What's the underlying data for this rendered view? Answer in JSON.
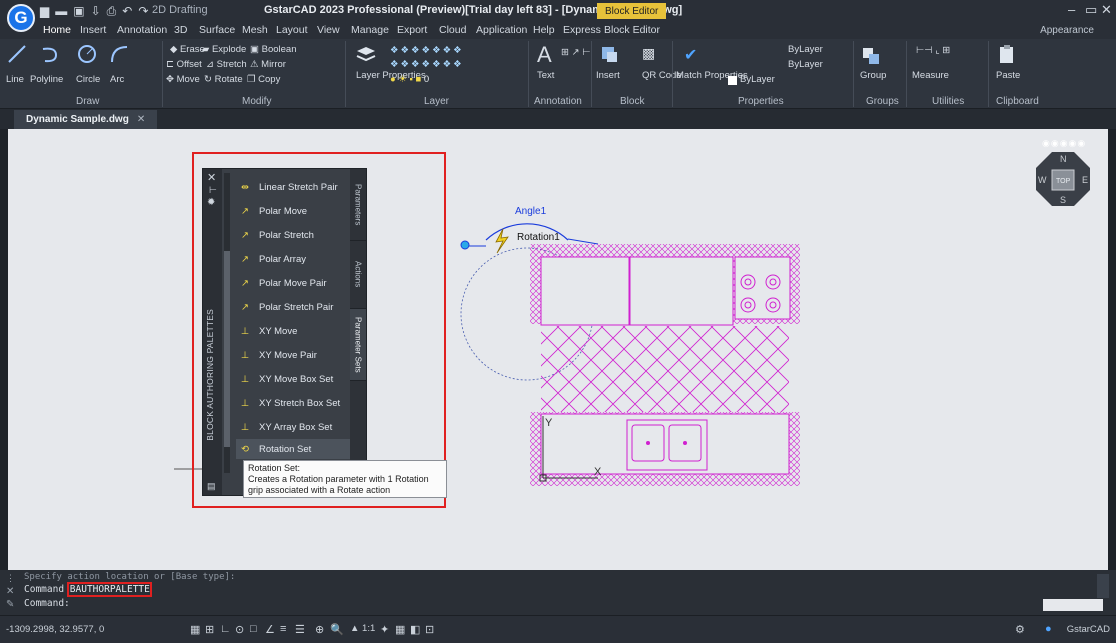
{
  "window": {
    "workspace": "2D Drafting",
    "title": "GstarCAD 2023 Professional (Preview)[Trial day left 83] - [Dynamic Sample.dwg]",
    "badge": "Block Editor",
    "logo": "G",
    "controls": [
      "–",
      "▭",
      "✕"
    ]
  },
  "menu": {
    "tabs": [
      "Home",
      "Insert",
      "Annotation",
      "3D",
      "Surface",
      "Mesh",
      "Layout",
      "View",
      "Manage",
      "Export",
      "Cloud",
      "Application",
      "Help",
      "Express",
      "Block Editor"
    ],
    "appearance": "Appearance"
  },
  "ribbon": {
    "draw": {
      "label": "Draw",
      "tools": [
        "Line",
        "Polyline",
        "Circle",
        "Arc"
      ]
    },
    "modify": {
      "label": "Modify",
      "tools": [
        "Erase",
        "Explode",
        "Boolean",
        "Offset",
        "Stretch",
        "Mirror",
        "Move",
        "Rotate",
        "Copy"
      ]
    },
    "layer": {
      "label": "Layer",
      "properties": "Layer Properties",
      "current": "0"
    },
    "annotation": {
      "label": "Annotation",
      "text": "Text"
    },
    "block": {
      "label": "Block",
      "insert": "Insert",
      "qr": "QR Code"
    },
    "properties": {
      "label": "Properties",
      "match": "Match Properties",
      "by1": "ByLayer",
      "by2": "ByLayer",
      "by3": "ByLayer"
    },
    "groups": {
      "label": "Groups",
      "group": "Group"
    },
    "utilities": {
      "label": "Utilities",
      "measure": "Measure"
    },
    "clipboard": {
      "label": "Clipboard",
      "paste": "Paste"
    }
  },
  "doc_tab": {
    "label": "Dynamic Sample.dwg",
    "close": "✕"
  },
  "canvas": {
    "viewcube": {
      "top": "TOP",
      "n": "N",
      "s": "S",
      "w": "W",
      "e": "E"
    },
    "angle_label": "Angle1",
    "rotation_label": "Rotation1",
    "axis_x": "X",
    "axis_y": "Y"
  },
  "palette": {
    "title": "BLOCK AUTHORING PALETTES",
    "items": [
      "Linear Stretch Pair",
      "Polar Move",
      "Polar Stretch",
      "Polar Array",
      "Polar Move Pair",
      "Polar Stretch Pair",
      "XY Move",
      "XY Move Pair",
      "XY Move Box Set",
      "XY Stretch Box Set",
      "XY Array Box Set",
      "Rotation Set"
    ],
    "tabs": [
      "Parameters",
      "Actions",
      "Parameter Sets"
    ]
  },
  "tooltip": {
    "title": "Rotation Set:",
    "body": "Creates a Rotation parameter with 1 Rotation grip associated with a Rotate action"
  },
  "command": {
    "history1": "Specify action location or [Base type]:",
    "label": "Command",
    "entered": "BAUTHORPALETTE",
    "prompt": "Command:"
  },
  "status": {
    "coords": "-1309.2998, 32.9577, 0",
    "scale": "1:1",
    "app": "GstarCAD"
  },
  "colors": {
    "accent": "#e7c23a",
    "highlight_red": "#e02020",
    "drawing_magenta": "#d020d0",
    "param_blue": "#1a3cdc"
  }
}
